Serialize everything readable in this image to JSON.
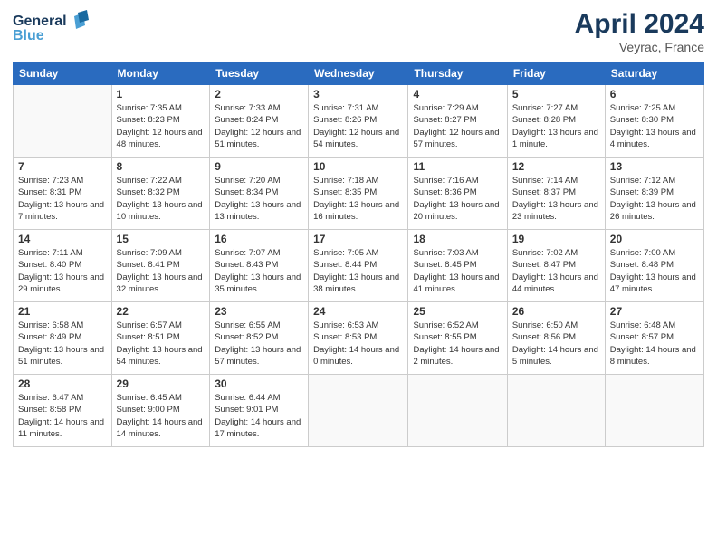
{
  "header": {
    "logo_line1": "General",
    "logo_line2": "Blue",
    "month_year": "April 2024",
    "location": "Veyrac, France"
  },
  "weekdays": [
    "Sunday",
    "Monday",
    "Tuesday",
    "Wednesday",
    "Thursday",
    "Friday",
    "Saturday"
  ],
  "weeks": [
    [
      {
        "day": "",
        "sunrise": "",
        "sunset": "",
        "daylight": ""
      },
      {
        "day": "1",
        "sunrise": "Sunrise: 7:35 AM",
        "sunset": "Sunset: 8:23 PM",
        "daylight": "Daylight: 12 hours and 48 minutes."
      },
      {
        "day": "2",
        "sunrise": "Sunrise: 7:33 AM",
        "sunset": "Sunset: 8:24 PM",
        "daylight": "Daylight: 12 hours and 51 minutes."
      },
      {
        "day": "3",
        "sunrise": "Sunrise: 7:31 AM",
        "sunset": "Sunset: 8:26 PM",
        "daylight": "Daylight: 12 hours and 54 minutes."
      },
      {
        "day": "4",
        "sunrise": "Sunrise: 7:29 AM",
        "sunset": "Sunset: 8:27 PM",
        "daylight": "Daylight: 12 hours and 57 minutes."
      },
      {
        "day": "5",
        "sunrise": "Sunrise: 7:27 AM",
        "sunset": "Sunset: 8:28 PM",
        "daylight": "Daylight: 13 hours and 1 minute."
      },
      {
        "day": "6",
        "sunrise": "Sunrise: 7:25 AM",
        "sunset": "Sunset: 8:30 PM",
        "daylight": "Daylight: 13 hours and 4 minutes."
      }
    ],
    [
      {
        "day": "7",
        "sunrise": "Sunrise: 7:23 AM",
        "sunset": "Sunset: 8:31 PM",
        "daylight": "Daylight: 13 hours and 7 minutes."
      },
      {
        "day": "8",
        "sunrise": "Sunrise: 7:22 AM",
        "sunset": "Sunset: 8:32 PM",
        "daylight": "Daylight: 13 hours and 10 minutes."
      },
      {
        "day": "9",
        "sunrise": "Sunrise: 7:20 AM",
        "sunset": "Sunset: 8:34 PM",
        "daylight": "Daylight: 13 hours and 13 minutes."
      },
      {
        "day": "10",
        "sunrise": "Sunrise: 7:18 AM",
        "sunset": "Sunset: 8:35 PM",
        "daylight": "Daylight: 13 hours and 16 minutes."
      },
      {
        "day": "11",
        "sunrise": "Sunrise: 7:16 AM",
        "sunset": "Sunset: 8:36 PM",
        "daylight": "Daylight: 13 hours and 20 minutes."
      },
      {
        "day": "12",
        "sunrise": "Sunrise: 7:14 AM",
        "sunset": "Sunset: 8:37 PM",
        "daylight": "Daylight: 13 hours and 23 minutes."
      },
      {
        "day": "13",
        "sunrise": "Sunrise: 7:12 AM",
        "sunset": "Sunset: 8:39 PM",
        "daylight": "Daylight: 13 hours and 26 minutes."
      }
    ],
    [
      {
        "day": "14",
        "sunrise": "Sunrise: 7:11 AM",
        "sunset": "Sunset: 8:40 PM",
        "daylight": "Daylight: 13 hours and 29 minutes."
      },
      {
        "day": "15",
        "sunrise": "Sunrise: 7:09 AM",
        "sunset": "Sunset: 8:41 PM",
        "daylight": "Daylight: 13 hours and 32 minutes."
      },
      {
        "day": "16",
        "sunrise": "Sunrise: 7:07 AM",
        "sunset": "Sunset: 8:43 PM",
        "daylight": "Daylight: 13 hours and 35 minutes."
      },
      {
        "day": "17",
        "sunrise": "Sunrise: 7:05 AM",
        "sunset": "Sunset: 8:44 PM",
        "daylight": "Daylight: 13 hours and 38 minutes."
      },
      {
        "day": "18",
        "sunrise": "Sunrise: 7:03 AM",
        "sunset": "Sunset: 8:45 PM",
        "daylight": "Daylight: 13 hours and 41 minutes."
      },
      {
        "day": "19",
        "sunrise": "Sunrise: 7:02 AM",
        "sunset": "Sunset: 8:47 PM",
        "daylight": "Daylight: 13 hours and 44 minutes."
      },
      {
        "day": "20",
        "sunrise": "Sunrise: 7:00 AM",
        "sunset": "Sunset: 8:48 PM",
        "daylight": "Daylight: 13 hours and 47 minutes."
      }
    ],
    [
      {
        "day": "21",
        "sunrise": "Sunrise: 6:58 AM",
        "sunset": "Sunset: 8:49 PM",
        "daylight": "Daylight: 13 hours and 51 minutes."
      },
      {
        "day": "22",
        "sunrise": "Sunrise: 6:57 AM",
        "sunset": "Sunset: 8:51 PM",
        "daylight": "Daylight: 13 hours and 54 minutes."
      },
      {
        "day": "23",
        "sunrise": "Sunrise: 6:55 AM",
        "sunset": "Sunset: 8:52 PM",
        "daylight": "Daylight: 13 hours and 57 minutes."
      },
      {
        "day": "24",
        "sunrise": "Sunrise: 6:53 AM",
        "sunset": "Sunset: 8:53 PM",
        "daylight": "Daylight: 14 hours and 0 minutes."
      },
      {
        "day": "25",
        "sunrise": "Sunrise: 6:52 AM",
        "sunset": "Sunset: 8:55 PM",
        "daylight": "Daylight: 14 hours and 2 minutes."
      },
      {
        "day": "26",
        "sunrise": "Sunrise: 6:50 AM",
        "sunset": "Sunset: 8:56 PM",
        "daylight": "Daylight: 14 hours and 5 minutes."
      },
      {
        "day": "27",
        "sunrise": "Sunrise: 6:48 AM",
        "sunset": "Sunset: 8:57 PM",
        "daylight": "Daylight: 14 hours and 8 minutes."
      }
    ],
    [
      {
        "day": "28",
        "sunrise": "Sunrise: 6:47 AM",
        "sunset": "Sunset: 8:58 PM",
        "daylight": "Daylight: 14 hours and 11 minutes."
      },
      {
        "day": "29",
        "sunrise": "Sunrise: 6:45 AM",
        "sunset": "Sunset: 9:00 PM",
        "daylight": "Daylight: 14 hours and 14 minutes."
      },
      {
        "day": "30",
        "sunrise": "Sunrise: 6:44 AM",
        "sunset": "Sunset: 9:01 PM",
        "daylight": "Daylight: 14 hours and 17 minutes."
      },
      {
        "day": "",
        "sunrise": "",
        "sunset": "",
        "daylight": ""
      },
      {
        "day": "",
        "sunrise": "",
        "sunset": "",
        "daylight": ""
      },
      {
        "day": "",
        "sunrise": "",
        "sunset": "",
        "daylight": ""
      },
      {
        "day": "",
        "sunrise": "",
        "sunset": "",
        "daylight": ""
      }
    ]
  ]
}
